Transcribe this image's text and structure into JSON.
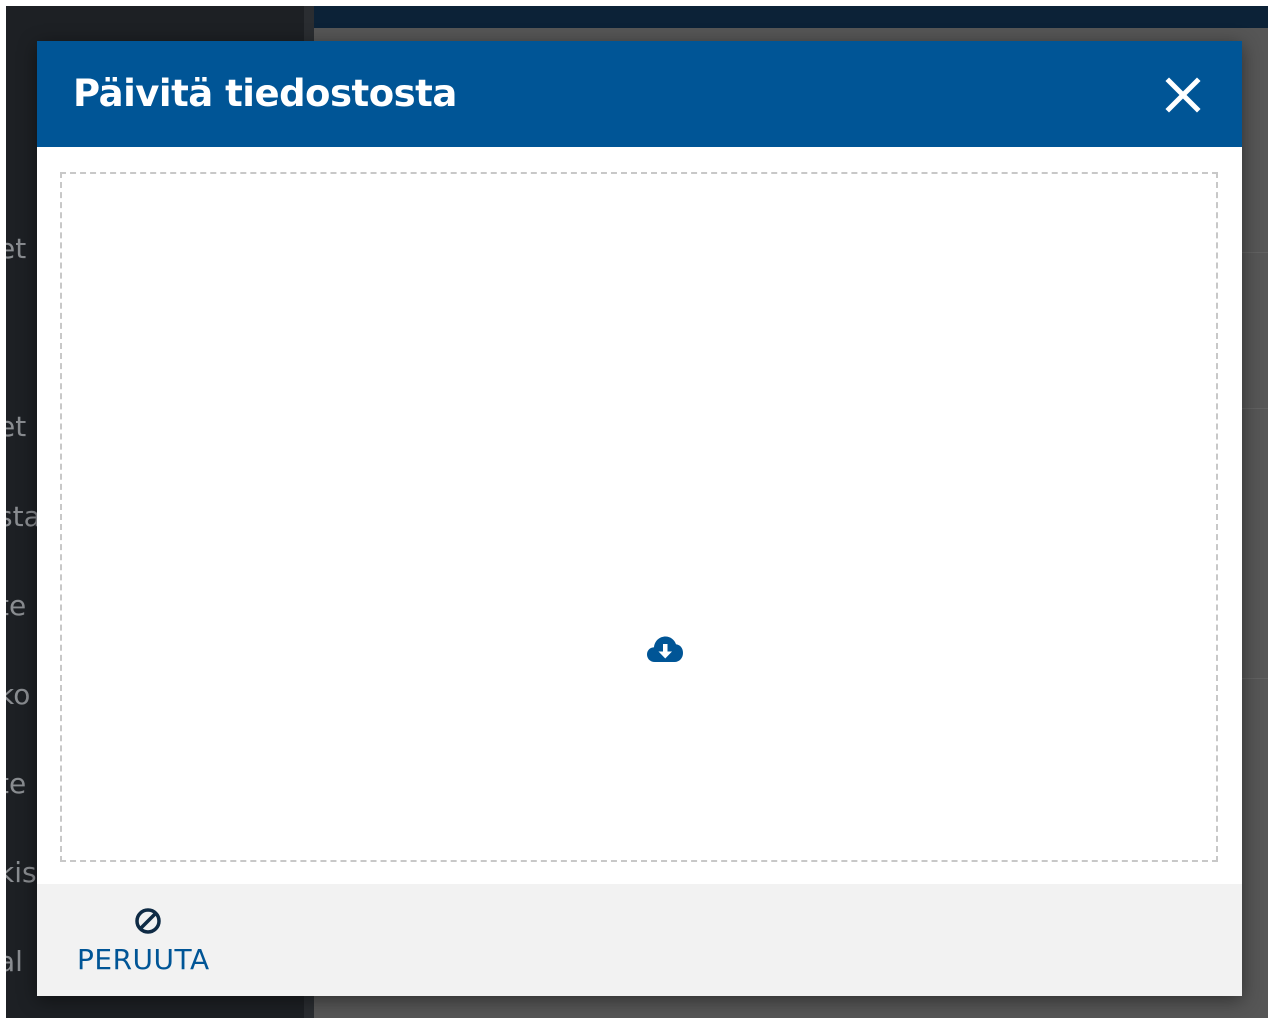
{
  "background": {
    "sidebar_items": [
      "et",
      "et",
      "sta",
      "te",
      "ko",
      "te",
      "kis",
      "al"
    ]
  },
  "modal": {
    "title": "Päivitä tiedostosta",
    "close_icon": "close-icon",
    "drop_zone": {
      "icon": "cloud-download-icon"
    },
    "footer": {
      "cancel_label": "PERUUTA",
      "cancel_icon": "ban-icon"
    }
  },
  "colors": {
    "header_bg": "#005596",
    "accent": "#005596",
    "footer_bg": "#f2f2f2",
    "overlay": "#5a5a5a",
    "sidebar_bg": "#1d2024"
  }
}
